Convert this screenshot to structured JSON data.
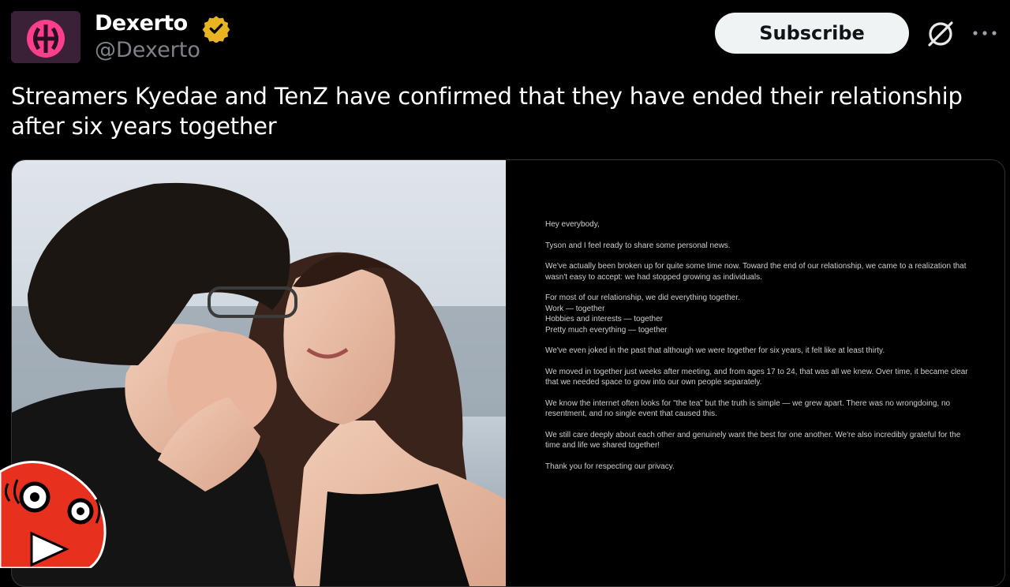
{
  "post": {
    "author": {
      "name": "Dexerto",
      "handle": "@Dexerto",
      "verified_icon": "gold-verified-badge-icon",
      "avatar_icon": "dexerto-logo"
    },
    "subscribe_label": "Subscribe",
    "text": "Streamers Kyedae and TenZ have confirmed that they have ended their relationship after six years together"
  },
  "statement": {
    "paragraphs": [
      "Hey everybody,",
      "Tyson and I feel ready to share some personal news.",
      "We've actually been broken up for quite some time now. Toward the end of our relationship, we came to a realization that wasn't easy to accept: we had stopped growing as individuals.",
      "For most of our relationship, we did everything together.\nWork — together\nHobbies and interests — together\nPretty much everything — together",
      "We've even joked in the past that although we were together for six years, it felt like at least thirty.",
      "We moved in together just weeks after meeting, and from ages 17 to 24, that was all we knew. Over time, it became clear that we needed space to grow into our own people separately.",
      "We know the internet often looks for \"the tea\" but the truth is simple — we grew apart. There was no wrongdoing, no resentment, and no single event that caused this.",
      "We still care deeply about each other and genuinely want the best for one another. We're also incredibly grateful for the time and life we shared together!",
      "Thank you for respecting our privacy."
    ]
  },
  "icons": {
    "grok": "grok-icon",
    "more": "more-options-icon",
    "sticker": "red-reaction-sticker"
  },
  "colors": {
    "verified_gold": "#e8b422",
    "subscribe_bg": "#eff3f4",
    "handle_gray": "#7d8288",
    "logo_pink": "#ff3f8e",
    "sticker_red": "#e8301f"
  }
}
